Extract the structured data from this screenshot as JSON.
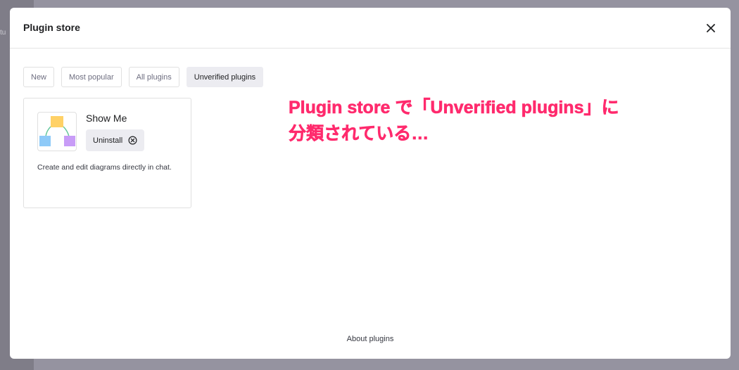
{
  "background": {
    "peek_text": "tu"
  },
  "modal": {
    "title": "Plugin store",
    "close_icon": "close-icon",
    "tabs": [
      {
        "label": "New",
        "active": false
      },
      {
        "label": "Most popular",
        "active": false
      },
      {
        "label": "All plugins",
        "active": false
      },
      {
        "label": "Unverified plugins",
        "active": true
      }
    ],
    "plugin": {
      "name": "Show Me",
      "uninstall_label": "Uninstall",
      "uninstall_icon": "circle-x-icon",
      "description": "Create and edit diagrams directly in chat.",
      "logo_icon": "diagram-logo-icon"
    },
    "about_link": "About plugins"
  },
  "annotation": {
    "line1": "Plugin store で「Unverified plugins」に",
    "line2": "分類されている…",
    "color": "#ff2a6d"
  }
}
